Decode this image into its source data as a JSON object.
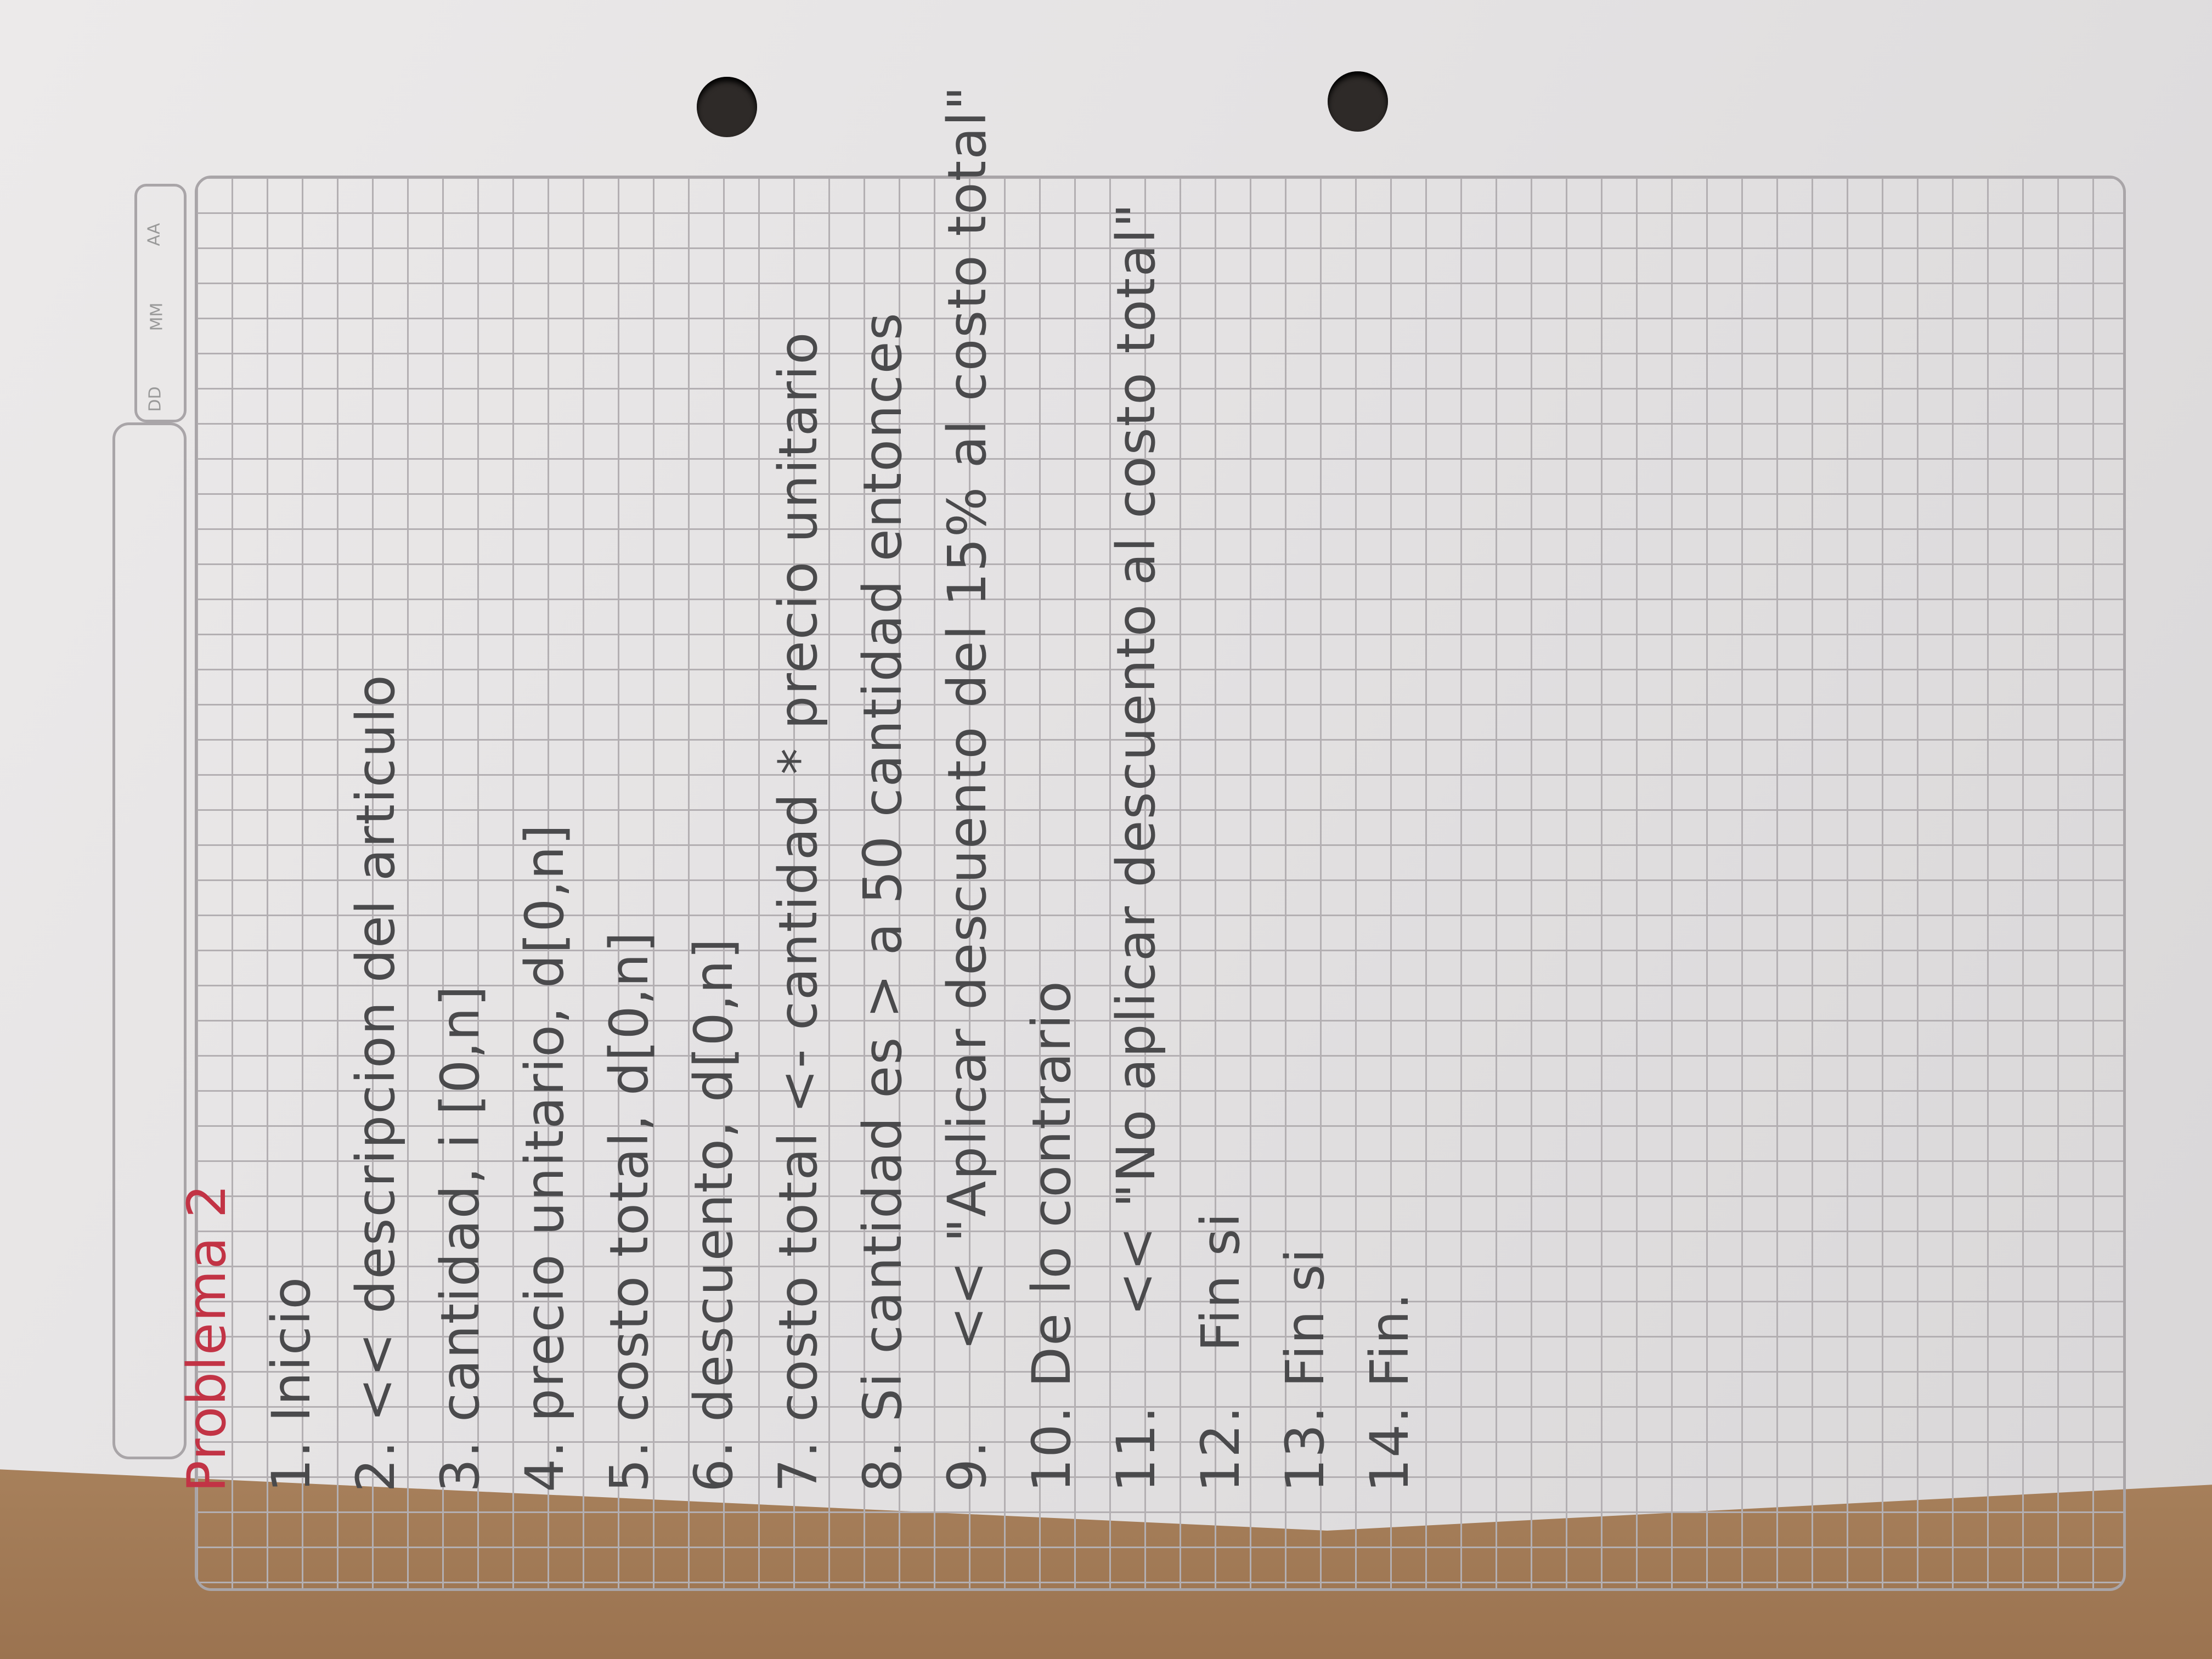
{
  "date_box": {
    "labels": [
      "DD",
      "MM",
      "AA"
    ]
  },
  "notes": {
    "title": "Problema 2",
    "lines": [
      "1. Inicio",
      "2. << descripcion del articulo",
      "3. cantidad, i [0,n]",
      "4. precio unitario, d[0,n]",
      "5. costo total, d[0,n]",
      "6. descuento, d[0,n]",
      "7. costo total <- cantidad * precio unitario",
      "8. Si cantidad es > a 50 cantidad entonces",
      "9.     << \"Aplicar descuento del 15% al costo total\"",
      "10. De lo contrario",
      "11.     << \"No aplicar descuento al costo total\"",
      "12.   Fin si",
      "13. Fin si",
      "14. Fin."
    ]
  },
  "colors": {
    "title_ink": "#c23345",
    "pencil": "#4a4a4c",
    "grid": "#b3afb2"
  }
}
